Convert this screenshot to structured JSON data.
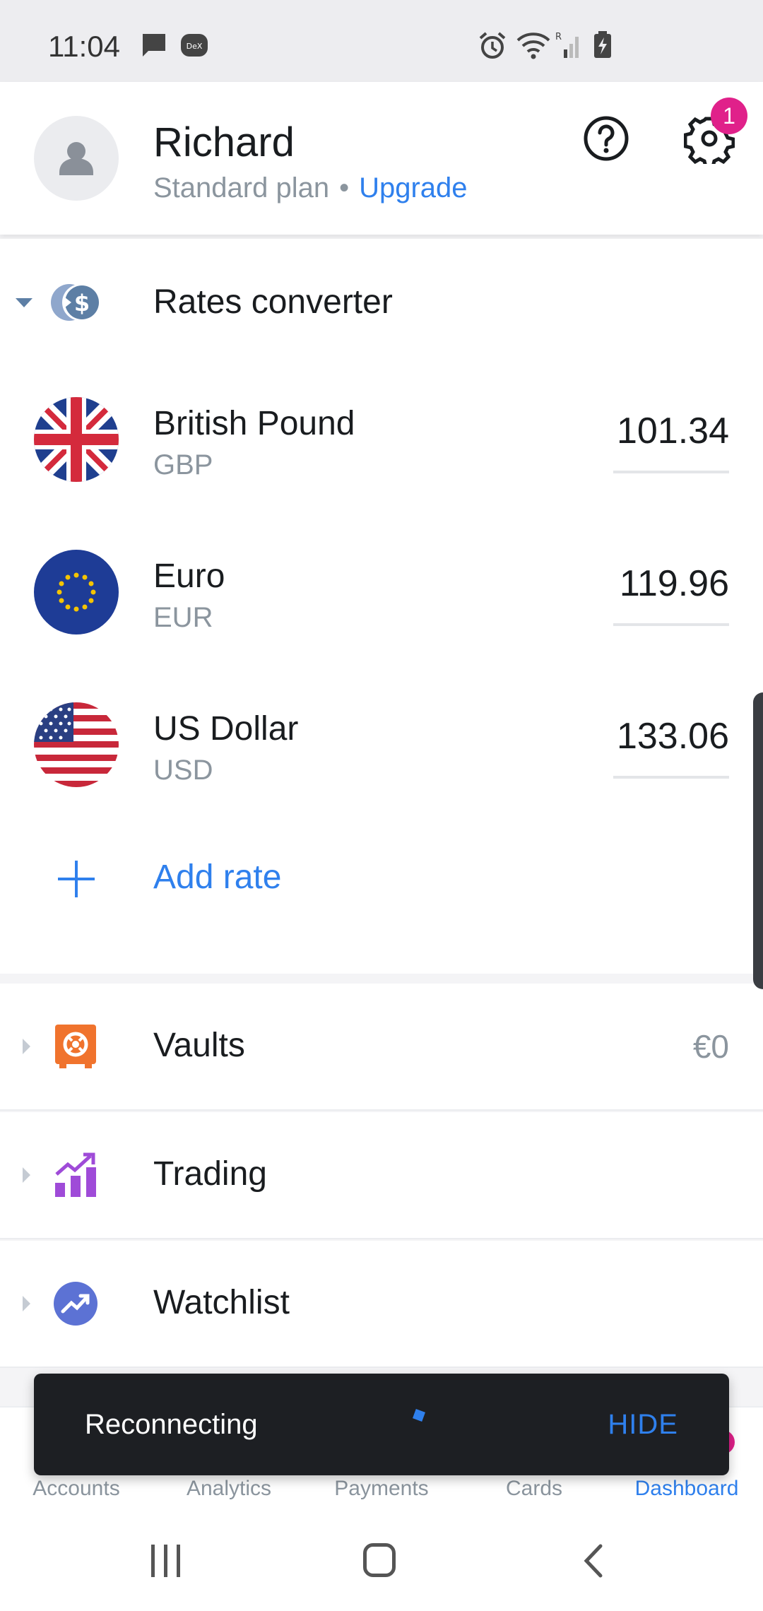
{
  "status_bar": {
    "time": "11:04"
  },
  "header": {
    "user_name": "Richard",
    "plan": "Standard plan",
    "separator": "•",
    "upgrade_label": "Upgrade",
    "notification_count": "1"
  },
  "rates": {
    "title": "Rates converter",
    "currencies": [
      {
        "name": "British Pound",
        "code": "GBP",
        "amount": "101.34",
        "flag": "uk-flag-icon"
      },
      {
        "name": "Euro",
        "code": "EUR",
        "amount": "119.96",
        "flag": "eu-flag-icon"
      },
      {
        "name": "US Dollar",
        "code": "USD",
        "amount": "133.06",
        "flag": "us-flag-icon"
      }
    ],
    "add_label": "Add rate"
  },
  "sections": [
    {
      "title": "Vaults",
      "value": "€0",
      "icon": "vault-icon",
      "color": "#f0732d"
    },
    {
      "title": "Trading",
      "value": "",
      "icon": "trading-icon",
      "color": "#9f4bd8"
    },
    {
      "title": "Watchlist",
      "value": "",
      "icon": "watchlist-icon",
      "color": "#5c72d4"
    }
  ],
  "tabs": [
    {
      "label": "Accounts",
      "active": false
    },
    {
      "label": "Analytics",
      "active": false
    },
    {
      "label": "Payments",
      "active": false
    },
    {
      "label": "Cards",
      "active": false
    },
    {
      "label": "Dashboard",
      "active": true
    }
  ],
  "snackbar": {
    "message": "Reconnecting",
    "action": "HIDE"
  },
  "colors": {
    "accent": "#2f80ed",
    "badge": "#e0218a",
    "text": "#191c1f",
    "muted": "#8b959e"
  }
}
